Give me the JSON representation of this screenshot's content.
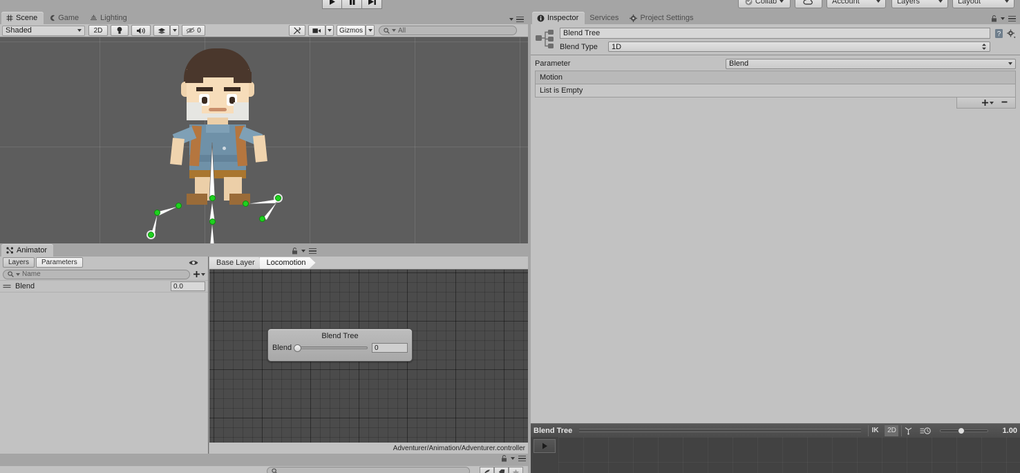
{
  "app": {
    "toolbar": {
      "play_icon": "play-icon",
      "pause_icon": "pause-icon",
      "step_icon": "step-icon",
      "collab_label": "Collab",
      "cloud_icon": "cloud-icon",
      "account_label": "Account",
      "layers_label": "Layers",
      "layout_label": "Layout"
    }
  },
  "scene": {
    "tabs": [
      {
        "label": "Scene",
        "icon": "grid-icon",
        "active": true
      },
      {
        "label": "Game",
        "icon": "gamepad-icon",
        "active": false
      },
      {
        "label": "Lighting",
        "icon": "lighting-icon",
        "active": false
      }
    ],
    "toolbar": {
      "draw_mode": "Shaded",
      "two_d_label": "2D",
      "light_icon": "light-bulb-icon",
      "audio_icon": "audio-icon",
      "fx_icon": "effects-icon",
      "hidden_count": "0",
      "hidden_icon": "hidden-objects-icon",
      "tools_icon": "tools-icon",
      "camera_icon": "camera-icon",
      "gizmos_label": "Gizmos",
      "search_placeholder": "All",
      "search_value": ""
    },
    "menu_icon": "panel-menu-icon"
  },
  "animator": {
    "tab": {
      "label": "Animator",
      "icon": "animator-icon"
    },
    "lock_icon": "lock-icon",
    "menu_icon": "panel-menu-icon",
    "side_tabs": [
      {
        "label": "Layers",
        "active": false
      },
      {
        "label": "Parameters",
        "active": true
      }
    ],
    "eye_icon": "eye-icon",
    "search_placeholder": "Name",
    "search_value": "",
    "add_icon": "add-icon",
    "parameters": [
      {
        "name": "Blend",
        "value": "0.0",
        "handle_icon": "drag-handle-icon"
      }
    ],
    "breadcrumbs": [
      {
        "label": "Base Layer",
        "active": false
      },
      {
        "label": "Locomotion",
        "active": true
      }
    ],
    "node": {
      "title": "Blend Tree",
      "slider_label": "Blend",
      "slider_value": "0",
      "slider_percent": 0
    },
    "status_path": "Adventurer/Animation/Adventurer.controller"
  },
  "inspector": {
    "tabs": [
      {
        "label": "Inspector",
        "icon": "info-icon",
        "active": true
      },
      {
        "label": "Services",
        "icon": "",
        "active": false
      },
      {
        "label": "Project Settings",
        "icon": "gear-icon",
        "active": false
      }
    ],
    "lock_icon": "lock-icon",
    "menu_icon": "panel-menu-icon",
    "asset_icon": "blend-tree-icon",
    "name_value": "Blend Tree",
    "help_icon": "help-icon",
    "preset_icon": "preset-gear-icon",
    "blend_type_label": "Blend Type",
    "blend_type_value": "1D",
    "parameter_label": "Parameter",
    "parameter_value": "Blend",
    "motion_header": "Motion",
    "empty_text": "List is Empty",
    "add_label": "+",
    "remove_label": "−"
  },
  "preview": {
    "title": "Blend Tree",
    "ik_label": "IK",
    "two_d_label": "2D",
    "pivot_icon": "pivot-icon",
    "speed_icon": "playback-speed-icon",
    "speed_value": "1.00",
    "speed_percent": 42,
    "play_icon": "play-icon"
  },
  "project": {
    "lock_icon": "lock-icon",
    "menu_icon": "panel-menu-icon",
    "search_placeholder": "",
    "search_value": "",
    "filter_icons": [
      "favorite-filter-icon",
      "label-filter-icon",
      "star-filter-icon"
    ]
  },
  "colors": {
    "chrome": "#c2c2c2",
    "window_bg": "#a5a5a5",
    "scene_bg": "#5d5d5d",
    "graph_bg": "#4b4b4b",
    "preview_bg": "#424242",
    "joint_green": "#1fd11f",
    "bone_white": "#ffffff"
  }
}
